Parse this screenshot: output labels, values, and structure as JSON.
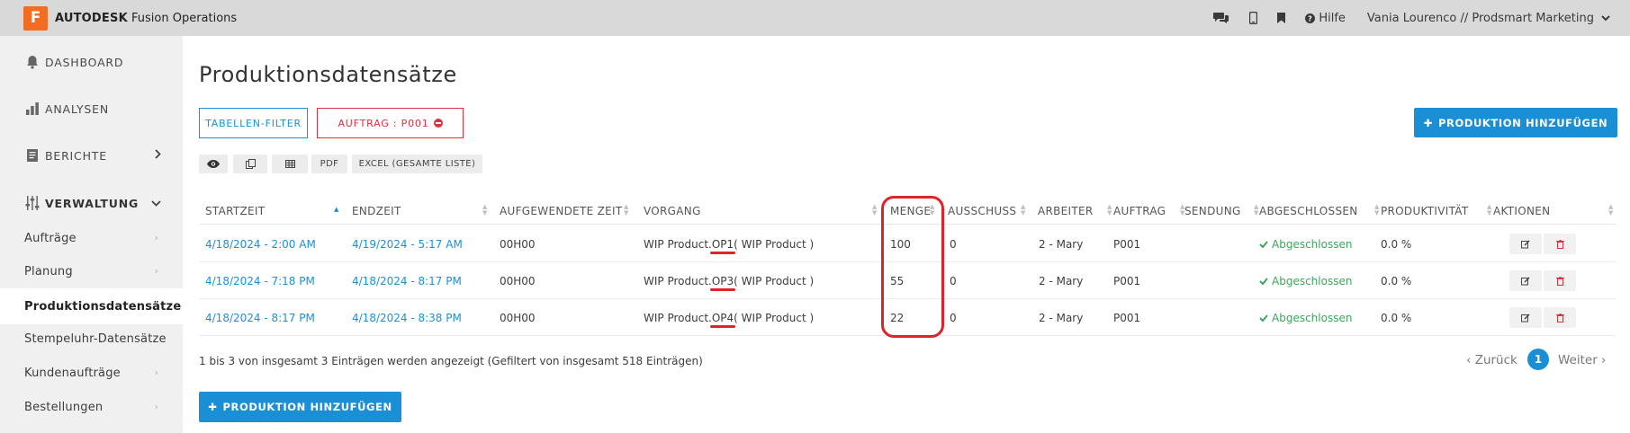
{
  "app": {
    "logo_letter": "F",
    "brand": "AUTODESK",
    "product": "Fusion Operations"
  },
  "topbar": {
    "help_label": "Hilfe",
    "user_label": "Vania Lourenco // Prodsmart Marketing"
  },
  "sidebar": {
    "items": [
      {
        "label": "DASHBOARD",
        "icon": "bell-icon"
      },
      {
        "label": "ANALYSEN",
        "icon": "bar-chart-icon"
      },
      {
        "label": "BERICHTE",
        "icon": "report-icon"
      },
      {
        "label": "VERWALTUNG",
        "icon": "sliders-icon"
      }
    ],
    "subitems": [
      {
        "label": "Aufträge"
      },
      {
        "label": "Planung"
      },
      {
        "label": "Produktionsdatensätze",
        "active": true
      },
      {
        "label": "Stempeluhr-Datensätze"
      },
      {
        "label": "Kundenaufträge"
      },
      {
        "label": "Bestellungen"
      }
    ]
  },
  "main": {
    "title": "Produktionsdatensätze",
    "filter_button": "TABELLEN-FILTER",
    "active_filter": "AUFTRAG : P001",
    "add_button": "PRODUKTION HINZUFÜGEN",
    "toolbar": {
      "pdf": "PDF",
      "excel": "EXCEL (GESAMTE LISTE)"
    }
  },
  "table": {
    "columns": [
      "STARTZEIT",
      "ENDZEIT",
      "AUFGEWENDETE ZEIT",
      "VORGANG",
      "MENGE",
      "AUSSCHUSS",
      "ARBEITER",
      "AUFTRAG",
      "SENDUNG",
      "ABGESCHLOSSEN",
      "PRODUKTIVITÄT",
      "AKTIONEN"
    ],
    "rows": [
      {
        "start": "4/18/2024 - 2:00 AM",
        "end": "4/19/2024 - 5:17 AM",
        "spent": "00H00",
        "op_prefix": "WIP Product.",
        "op_code": "OP1",
        "op_suffix": " ( WIP Product )",
        "qty": "100",
        "scrap": "0",
        "worker": "2 - Mary",
        "order": "P001",
        "shipment": "",
        "done": "Abgeschlossen",
        "productivity": "0.0 %"
      },
      {
        "start": "4/18/2024 - 7:18 PM",
        "end": "4/18/2024 - 8:17 PM",
        "spent": "00H00",
        "op_prefix": "WIP Product.",
        "op_code": "OP3",
        "op_suffix": " ( WIP Product )",
        "qty": "55",
        "scrap": "0",
        "worker": "2 - Mary",
        "order": "P001",
        "shipment": "",
        "done": "Abgeschlossen",
        "productivity": "0.0 %"
      },
      {
        "start": "4/18/2024 - 8:17 PM",
        "end": "4/18/2024 - 8:38 PM",
        "spent": "00H00",
        "op_prefix": "WIP Product.",
        "op_code": "OP4",
        "op_suffix": " ( WIP Product )",
        "qty": "22",
        "scrap": "0",
        "worker": "2 - Mary",
        "order": "P001",
        "shipment": "",
        "done": "Abgeschlossen",
        "productivity": "0.0 %"
      }
    ]
  },
  "footer": {
    "info": "1 bis 3 von insgesamt 3 Einträgen werden angezeigt (Gefiltert von insgesamt 518 Einträgen)",
    "prev": "‹ Zurück",
    "page": "1",
    "next": "Weiter ›"
  },
  "colors": {
    "accent": "#1b8fd6",
    "danger": "#d9333f",
    "success": "#3ca55c",
    "brand": "#f26c22"
  }
}
